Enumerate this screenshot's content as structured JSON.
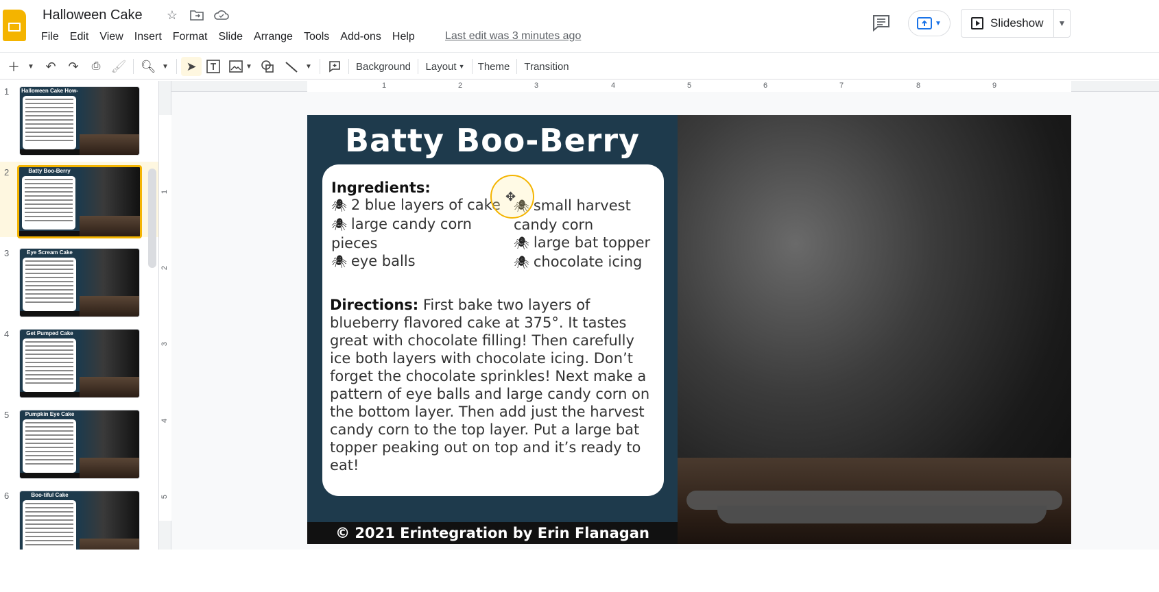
{
  "app": {
    "doc_title": "Halloween Cake",
    "last_edit": "Last edit was 3 minutes ago",
    "brand_color": "#f4b400",
    "slideshow_label": "Slideshow"
  },
  "menu": [
    "File",
    "Edit",
    "View",
    "Insert",
    "Format",
    "Slide",
    "Arrange",
    "Tools",
    "Add-ons",
    "Help"
  ],
  "toolbar": {
    "background": "Background",
    "layout": "Layout",
    "theme": "Theme",
    "transition": "Transition"
  },
  "ruler": {
    "h": [
      "1",
      "2",
      "3",
      "4",
      "5",
      "6",
      "7",
      "8",
      "9"
    ],
    "v": [
      "1",
      "2",
      "3",
      "4",
      "5"
    ]
  },
  "slides": [
    {
      "num": "1",
      "title": "Halloween Cake How-To"
    },
    {
      "num": "2",
      "title": "Batty Boo-Berry"
    },
    {
      "num": "3",
      "title": "Eye Scream Cake"
    },
    {
      "num": "4",
      "title": "Get Pumped Cake"
    },
    {
      "num": "5",
      "title": "Pumpkin Eye Cake"
    },
    {
      "num": "6",
      "title": "Boo-tiful Cake"
    }
  ],
  "current_slide": {
    "title": "Batty Boo-Berry",
    "ingredients_heading": "Ingredients:",
    "col1": [
      "2 blue layers of cake",
      "large candy corn",
      "pieces",
      "eye balls"
    ],
    "col2": [
      "small harvest",
      "candy corn",
      "large bat topper",
      "chocolate icing"
    ],
    "directions_label": "Directions:",
    "directions_text": " First bake two layers of blueberry flavored cake at 375°.  It tastes great with chocolate filling! Then carefully ice both layers with chocolate icing.  Don’t forget the chocolate sprinkles! Next make a pattern of eye balls and large candy corn on the bottom layer.  Then add just the harvest candy corn to the top layer.  Put a large bat topper peaking out on top and it’s ready to eat!",
    "footer": "© 2021 Erintegration by Erin Flanagan"
  }
}
